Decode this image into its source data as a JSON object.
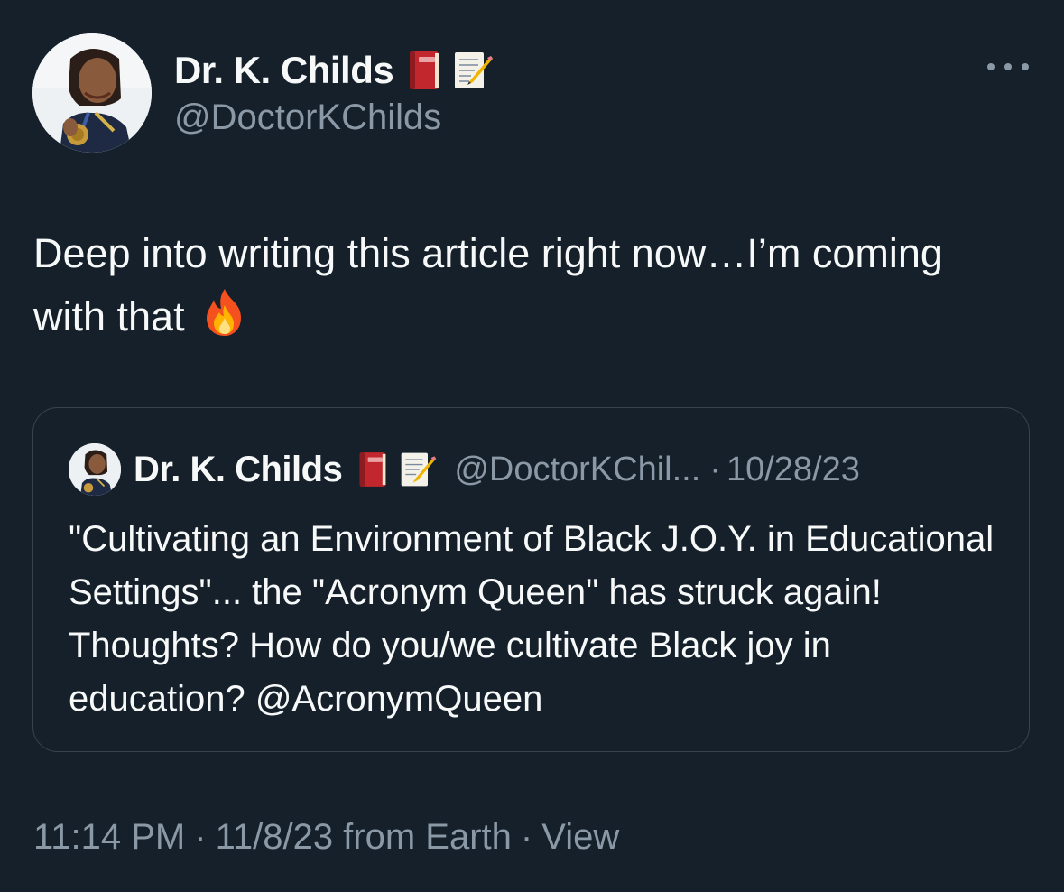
{
  "author": {
    "display_name": "Dr. K. Childs",
    "handle": "@DoctorKChilds",
    "name_emojis": [
      "closed-book-emoji",
      "memo-emoji"
    ]
  },
  "tweet": {
    "text": "Deep into writing this article right now…I’m coming with that",
    "trailing_emoji": "fire-emoji"
  },
  "quoted_tweet": {
    "display_name": "Dr. K. Childs",
    "handle": "@DoctorKChil...",
    "dot": "·",
    "date": "10/28/23",
    "text": "\"Cultivating an Environment of Black J.O.Y. in Educational Settings\"... the \"Acronym Queen\" has struck again! Thoughts? How do you/we cultivate Black joy in education? @AcronymQueen"
  },
  "footer": {
    "time": "11:14 PM",
    "sep1": "·",
    "date_source": "11/8/23 from Earth",
    "sep2": "·",
    "view_label": "View"
  },
  "colors": {
    "background": "#15202b",
    "primary_text": "#f7f9f9",
    "secondary_text": "#8b98a5",
    "border": "#38444d"
  }
}
